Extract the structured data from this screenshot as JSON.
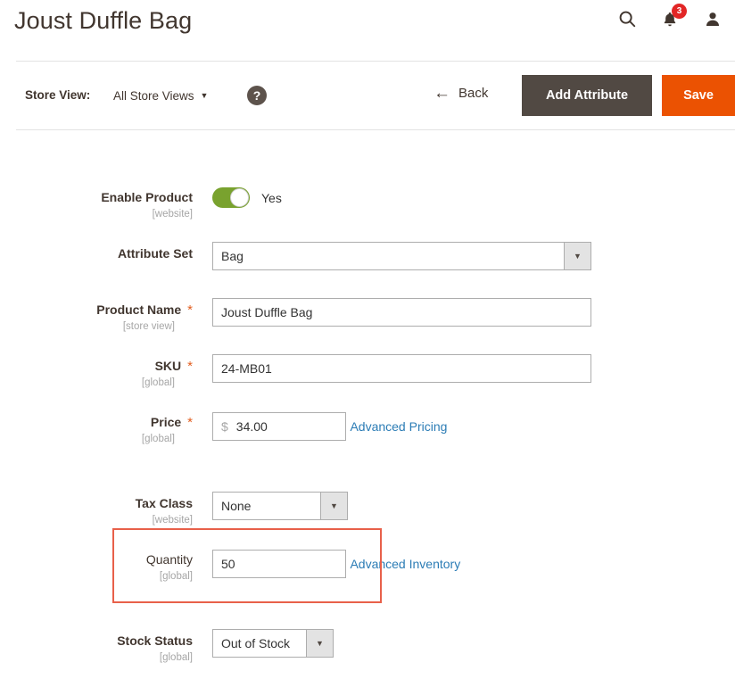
{
  "header": {
    "title": "Joust Duffle Bag",
    "icons": {
      "search": "search-icon",
      "notifications": "bell-icon",
      "notifications_count": "3",
      "account": "user-icon"
    }
  },
  "toolbar": {
    "store_view_label": "Store View:",
    "store_view_value": "All Store Views",
    "store_view_caret": "▼",
    "help": "?",
    "back_label": "Back",
    "back_arrow": "←",
    "add_attribute_label": "Add Attribute",
    "save_label": "Save"
  },
  "form": {
    "enable_product": {
      "label": "Enable Product",
      "scope": "[website]",
      "value": "Yes",
      "state": "on"
    },
    "attribute_set": {
      "label": "Attribute Set",
      "scope": "",
      "value": "Bag",
      "caret": "▼"
    },
    "product_name": {
      "label": "Product Name",
      "scope": "[store view]",
      "required": "*",
      "value": "Joust Duffle Bag"
    },
    "sku": {
      "label": "SKU",
      "scope": "[global]",
      "required": "*",
      "value": "24-MB01"
    },
    "price": {
      "label": "Price",
      "scope": "[global]",
      "required": "*",
      "currency": "$",
      "value": "34.00",
      "link": "Advanced Pricing"
    },
    "tax_class": {
      "label": "Tax Class",
      "scope": "[website]",
      "value": "None",
      "caret": "▼"
    },
    "quantity": {
      "label": "Quantity",
      "scope": "[global]",
      "value": "50",
      "link": "Advanced Inventory"
    },
    "stock_status": {
      "label": "Stock Status",
      "scope": "[global]",
      "value": "Out of Stock",
      "caret": "▼"
    }
  },
  "colors": {
    "save_button": "#eb5202",
    "add_attribute_button": "#514943",
    "toggle_on": "#79a22e",
    "highlight_border": "#e8604a",
    "link": "#2b7cb5",
    "required_asterisk": "#e25d1e",
    "notification_badge": "#e22626"
  }
}
